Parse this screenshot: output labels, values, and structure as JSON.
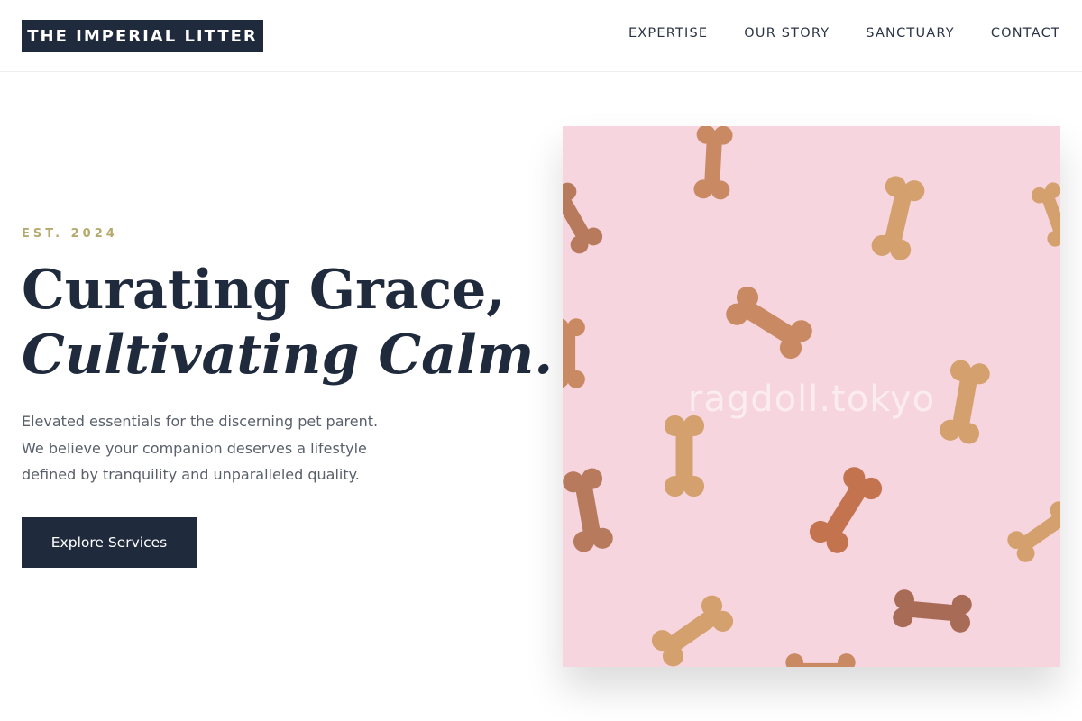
{
  "header": {
    "logo": "THE IMPERIAL LITTER",
    "nav": [
      "EXPERTISE",
      "OUR STORY",
      "SANCTUARY",
      "CONTACT"
    ]
  },
  "hero": {
    "eyebrow": "EST. 2024",
    "headline_line1": "Curating Grace,",
    "headline_line2": "Cultivating Calm.",
    "description": [
      "Elevated essentials for the discerning pet parent.",
      "We believe your companion deserves a lifestyle",
      "defined by tranquility and unparalleled quality."
    ],
    "cta_label": "Explore Services",
    "image": {
      "subject": "dog bone biscuits on pink background",
      "watermark": "ragdoll.tokyo"
    }
  },
  "colors": {
    "navy": "#1f2a3d",
    "gold": "#b5aa6e",
    "body_text": "#5a606b",
    "image_bg": "#f6d5de"
  }
}
